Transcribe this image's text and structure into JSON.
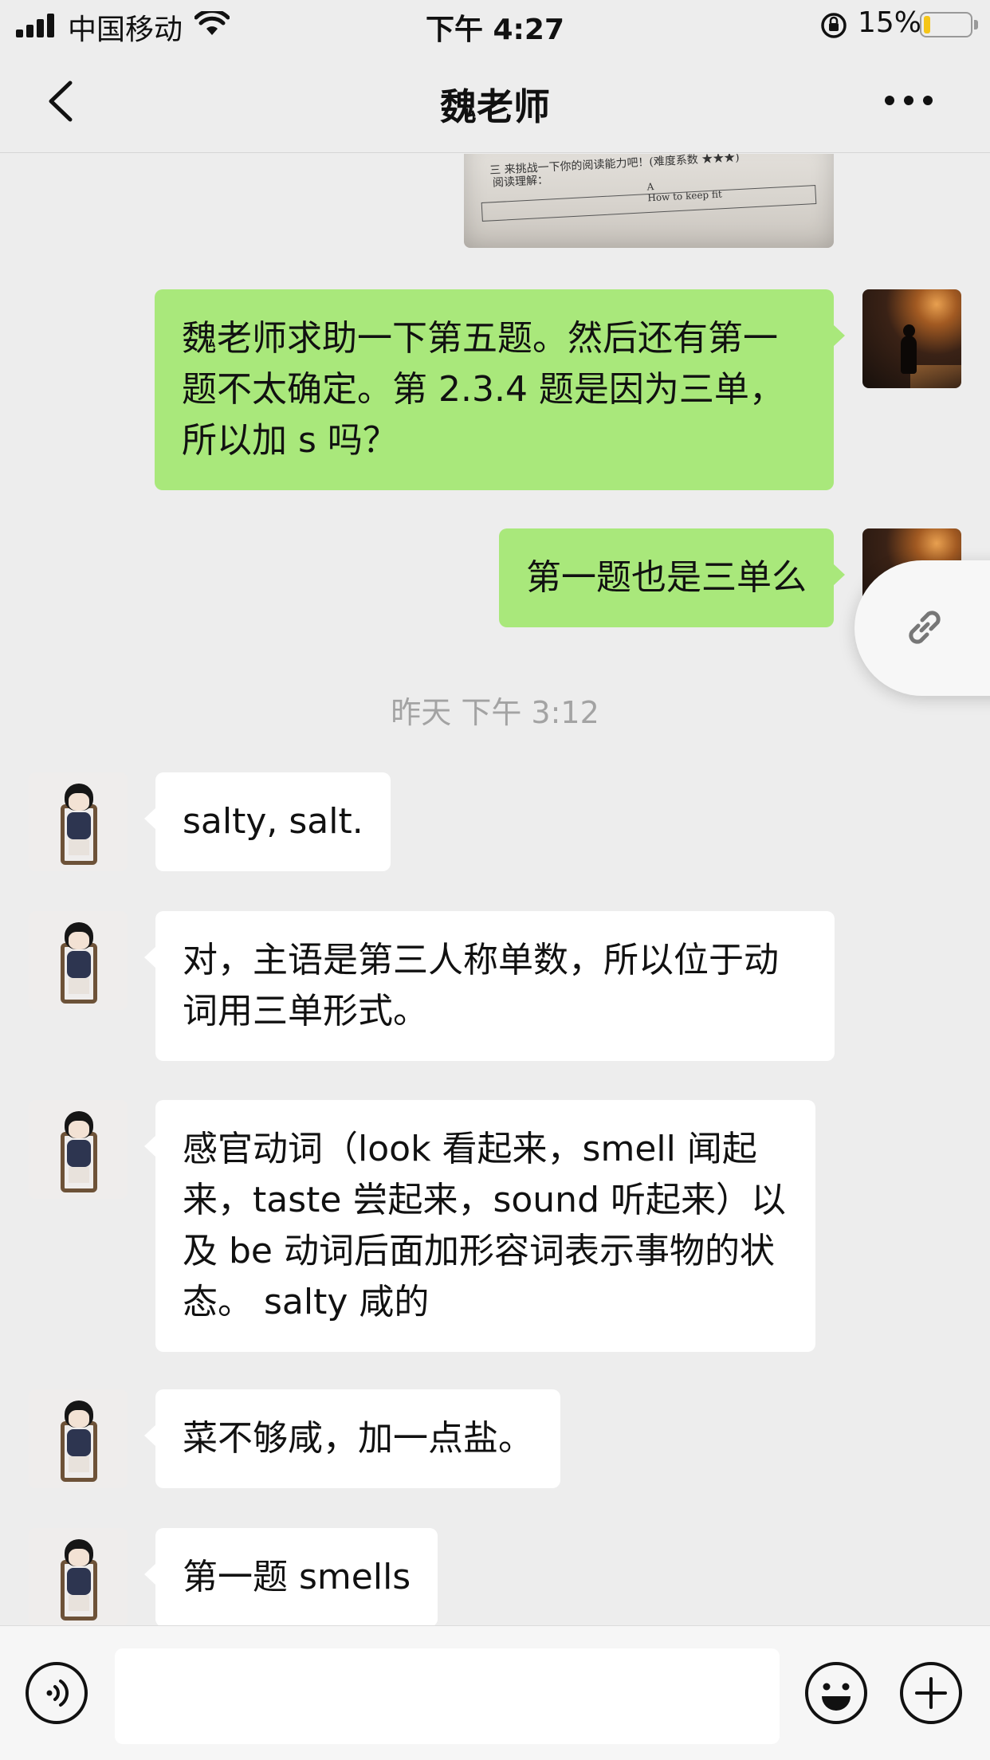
{
  "status_bar": {
    "carrier": "中国移动",
    "time": "下午 4:27",
    "battery_percent": "15%",
    "battery_level": 0.15,
    "battery_color": "#f5c518"
  },
  "header": {
    "title": "魏老师",
    "back_icon": "chevron-left-icon",
    "more_icon": "more-dots-icon"
  },
  "photo_message": {
    "line1": "三 来挑战一下你的阅读能力吧！(难度系数 ★★★)",
    "line2": "阅读理解：",
    "box_letter": "A",
    "box_text": "How to keep fit"
  },
  "messages_out": [
    {
      "text": "魏老师求助一下第五题。然后还有第一题不太确定。第 2.3.4 题是因为三单，所以加 s 吗？"
    },
    {
      "text": "第一题也是三单么"
    }
  ],
  "timestamp": "昨天 下午 3:12",
  "messages_in": [
    {
      "text": "salty, salt."
    },
    {
      "text": "对，主语是第三人称单数，所以位于动词用三单形式。"
    },
    {
      "text": "感官动词（look 看起来，smell 闻起来，taste 尝起来，sound 听起来）以及 be 动词后面加形容词表示事物的状态。 salty 咸的"
    },
    {
      "text": "菜不够咸，加一点盐。"
    },
    {
      "text": "第一题 smells"
    }
  ],
  "floating_button": {
    "icon": "link-icon"
  },
  "input_bar": {
    "placeholder": "",
    "voice_icon": "voice-icon",
    "emoji_icon": "emoji-icon",
    "plus_icon": "plus-icon"
  },
  "colors": {
    "background": "#ededed",
    "outgoing_bubble": "#a9e87b",
    "incoming_bubble": "#ffffff",
    "timestamp_text": "#a3a3a3"
  }
}
